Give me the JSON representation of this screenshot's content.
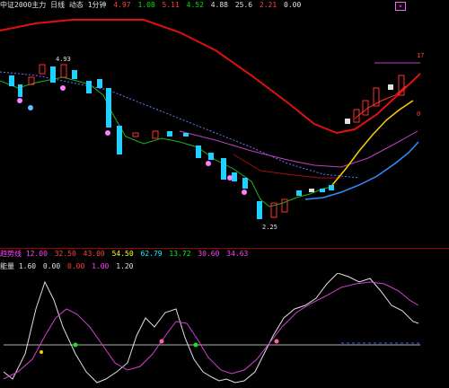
{
  "header": {
    "items": [
      {
        "text": "中证2000主力 日线 动态 1分钟",
        "color": "#e0e0e0"
      },
      {
        "text": "4.97",
        "color": "#ff4040"
      },
      {
        "text": "1.08",
        "color": "#00e000"
      },
      {
        "text": "5.11",
        "color": "#ff4040"
      },
      {
        "text": "4.52",
        "color": "#00e000"
      },
      {
        "text": "4.88",
        "color": "#e0e0e0"
      },
      {
        "text": "25.6",
        "color": "#e0e0e0"
      },
      {
        "text": "2.21",
        "color": "#ff4040"
      },
      {
        "text": "0.00",
        "color": "#e0e0e0"
      }
    ],
    "close_icon_color": "#ff60ff"
  },
  "price_chart": {
    "labels": {
      "high": "4.93",
      "low": "2.25",
      "right_top": "17",
      "right_zero": "0"
    }
  },
  "indicator_header": {
    "items": [
      {
        "text": "趋势线 12.00",
        "color": "#ff40ff"
      },
      {
        "text": "32.50",
        "color": "#ff4040"
      },
      {
        "text": "43.00",
        "color": "#ff4040"
      },
      {
        "text": "54.50",
        "color": "#ffff00"
      },
      {
        "text": "62.79",
        "color": "#00ffff"
      },
      {
        "text": "13.72",
        "color": "#00ff00"
      },
      {
        "text": "30.60",
        "color": "#ff40ff"
      },
      {
        "text": "34.63",
        "color": "#ff40ff"
      }
    ]
  },
  "indicator_sub": {
    "items": [
      {
        "text": "能量 1.60",
        "color": "#e0e0e0"
      },
      {
        "text": "0.00",
        "color": "#e0e0e0"
      },
      {
        "text": "0.00",
        "color": "#ff4040"
      },
      {
        "text": "1.00",
        "color": "#ff40ff"
      },
      {
        "text": "1.20",
        "color": "#e0e0e0"
      }
    ]
  }
}
